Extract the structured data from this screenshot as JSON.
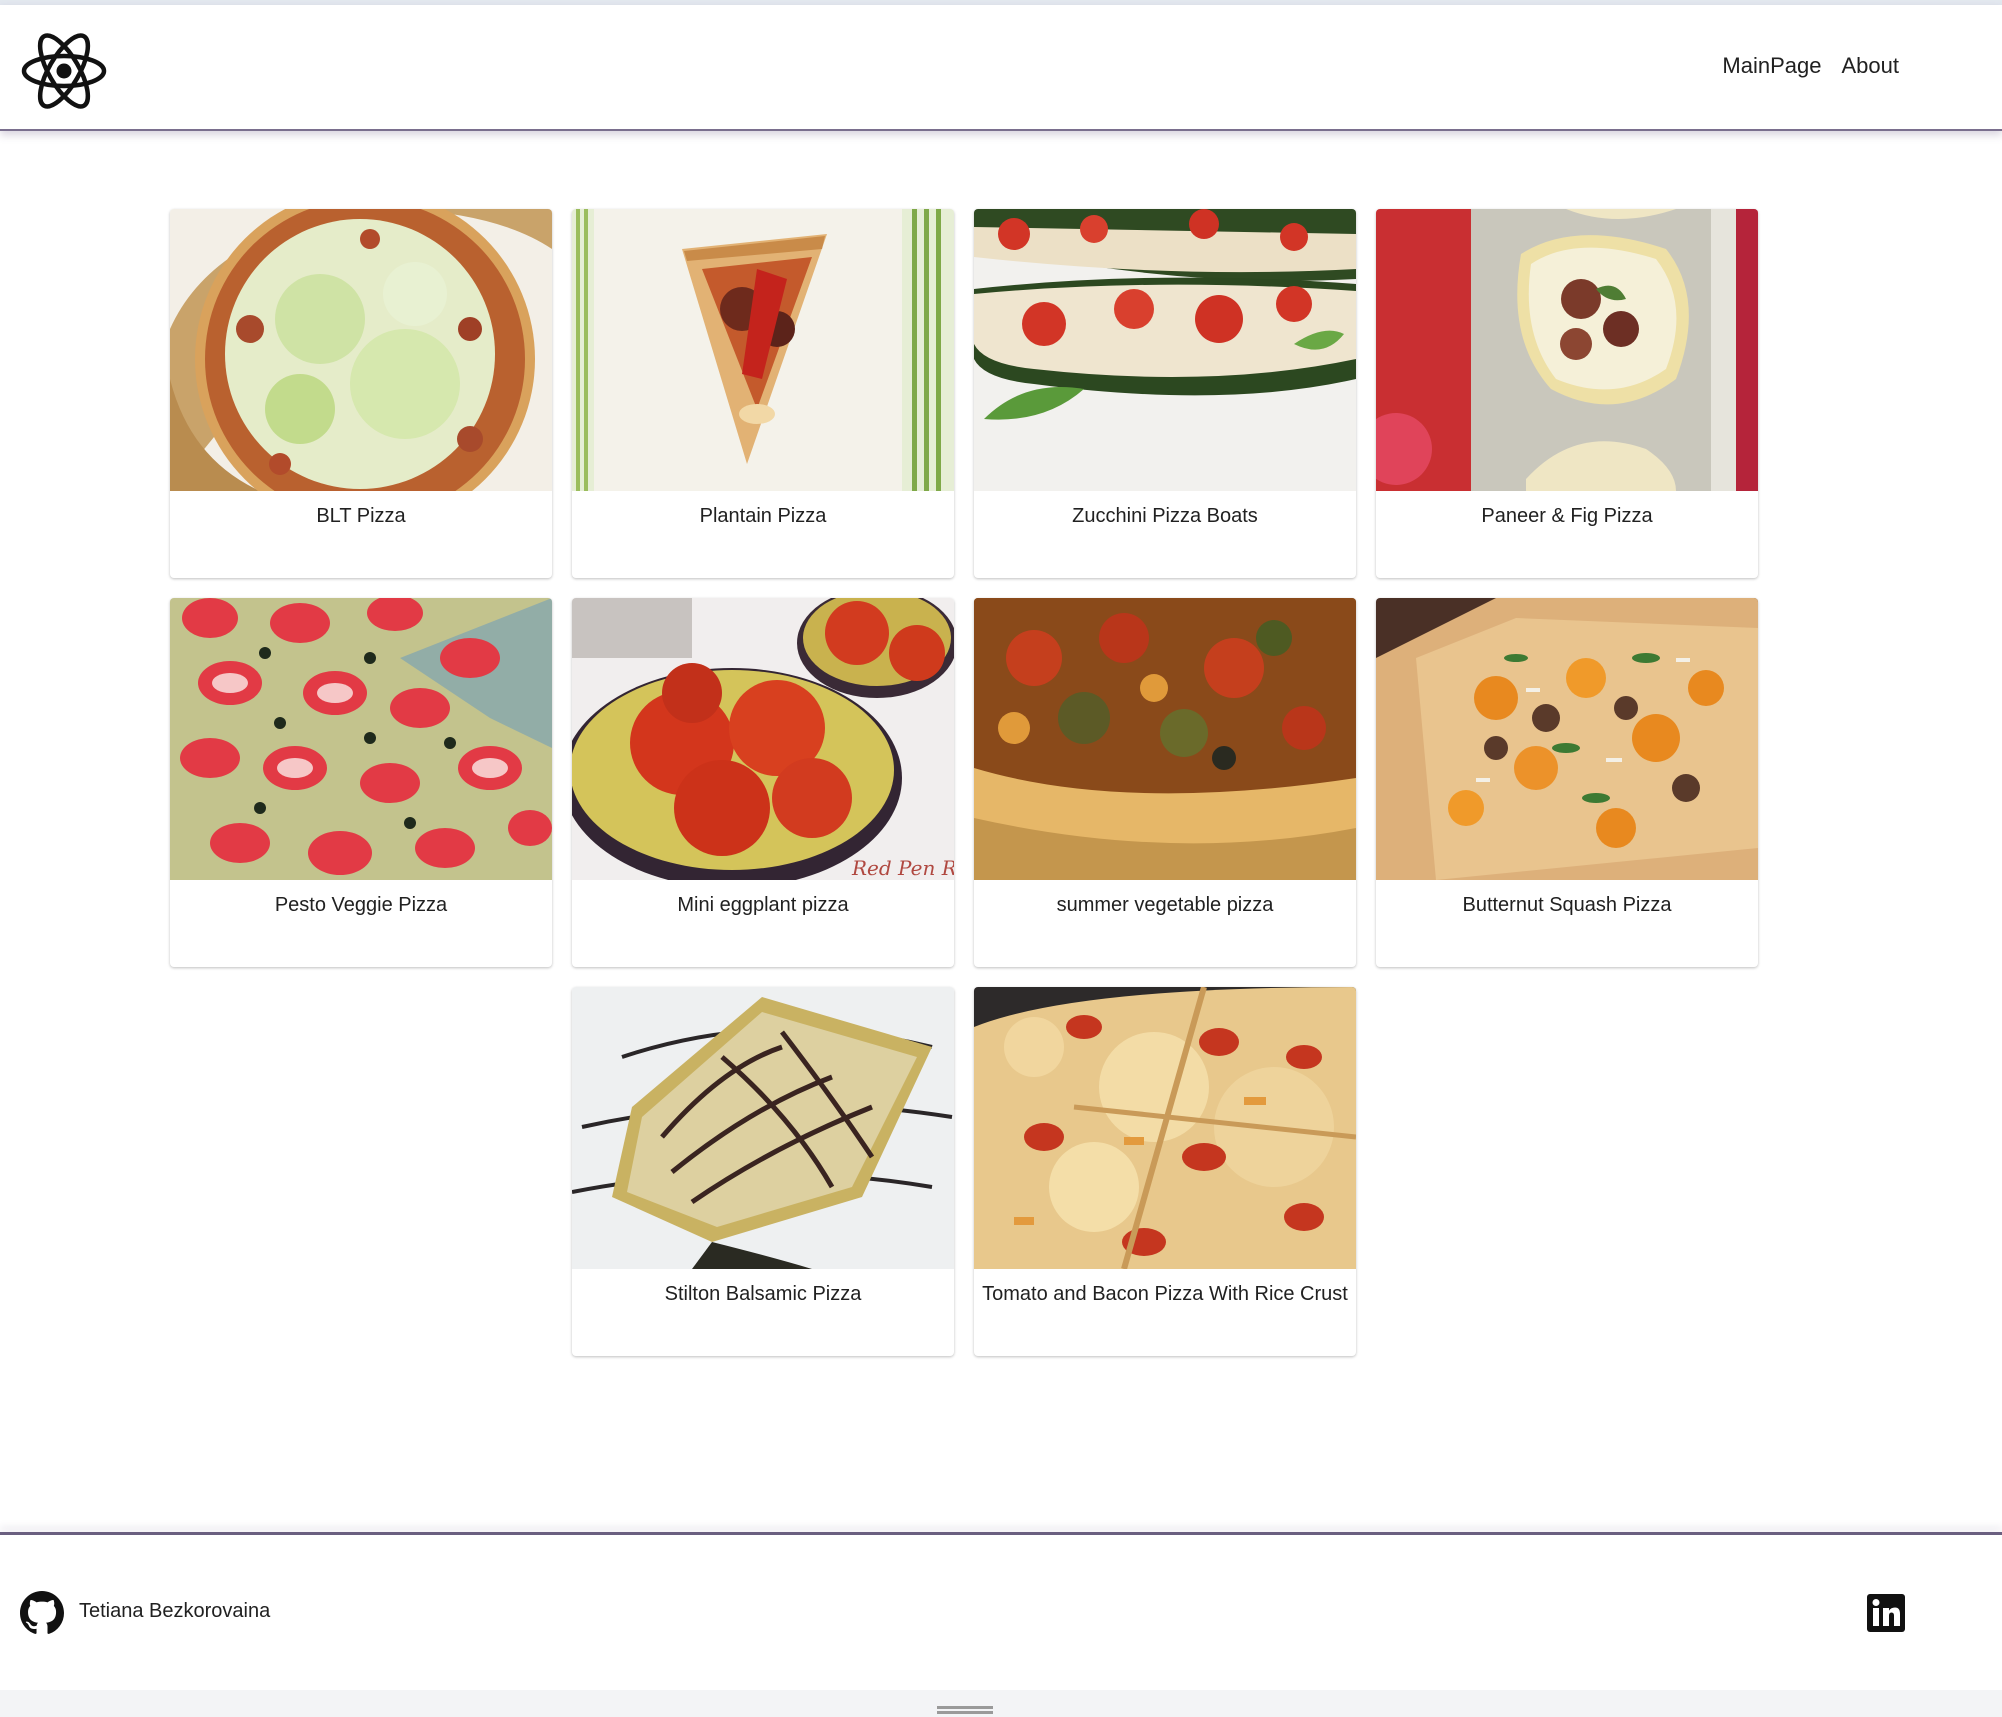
{
  "nav": {
    "logo_icon": "atom-icon",
    "links": [
      "MainPage",
      "About"
    ]
  },
  "recipes": [
    {
      "title": "BLT Pizza",
      "image": "blt-pizza-photo"
    },
    {
      "title": "Plantain Pizza",
      "image": "plantain-pizza-photo"
    },
    {
      "title": "Zucchini Pizza Boats",
      "image": "zucchini-pizza-boats-photo"
    },
    {
      "title": "Paneer & Fig Pizza",
      "image": "paneer-fig-pizza-photo"
    },
    {
      "title": "Pesto Veggie Pizza",
      "image": "pesto-veggie-pizza-photo"
    },
    {
      "title": "Mini eggplant pizza",
      "image": "mini-eggplant-pizza-photo",
      "watermark": "Red Pen Reci"
    },
    {
      "title": "summer vegetable pizza",
      "image": "summer-vegetable-pizza-photo"
    },
    {
      "title": "Butternut Squash Pizza",
      "image": "butternut-squash-pizza-photo"
    },
    {
      "title": "Stilton Balsamic Pizza",
      "image": "stilton-balsamic-pizza-photo"
    },
    {
      "title": "Tomato and Bacon Pizza With Rice Crust",
      "image": "tomato-bacon-pizza-photo"
    }
  ],
  "footer": {
    "author": "Tetiana Bezkorovaina",
    "github_icon": "github-icon",
    "linkedin_icon": "linkedin-icon"
  },
  "colors": {
    "header_border": "#7a6f8e",
    "text": "#212121",
    "background": "#ffffff"
  }
}
